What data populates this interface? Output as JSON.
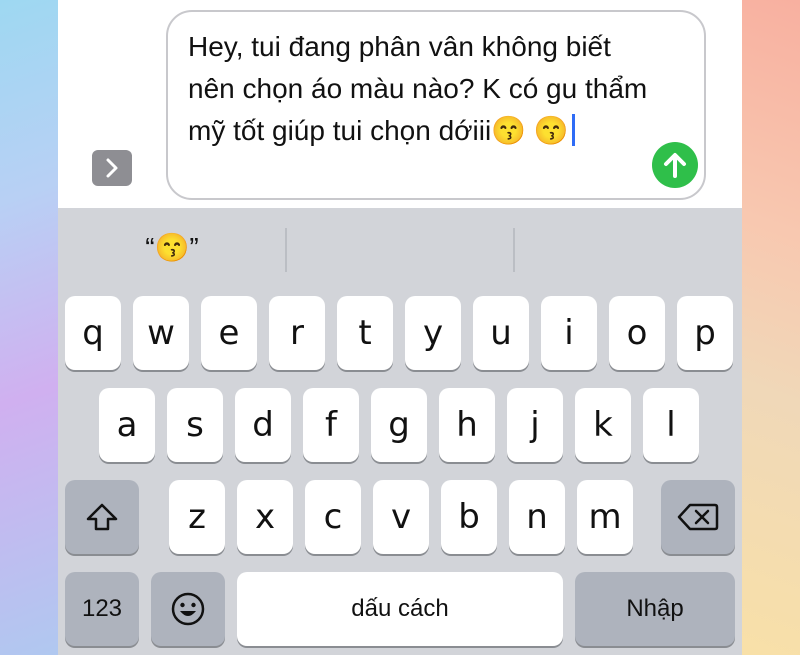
{
  "compose": {
    "message": "Hey, tui đang phân vân không biết nên chọn áo màu nào? K có gu thẩm mỹ tốt giúp tui chọn dớiii😙 😙"
  },
  "suggestions": [
    "“😙”",
    "",
    ""
  ],
  "keyboard": {
    "row1": [
      "q",
      "w",
      "e",
      "r",
      "t",
      "y",
      "u",
      "i",
      "o",
      "p"
    ],
    "row2": [
      "a",
      "s",
      "d",
      "f",
      "g",
      "h",
      "j",
      "k",
      "l"
    ],
    "row3": [
      "z",
      "x",
      "c",
      "v",
      "b",
      "n",
      "m"
    ],
    "numbers_label": "123",
    "space_label": "dấu cách",
    "return_label": "Nhập"
  },
  "icons": {
    "expand": "chevron-right-icon",
    "send": "arrow-up-icon",
    "shift": "shift-icon",
    "delete": "delete-icon",
    "emoji": "emoji-icon"
  },
  "colors": {
    "send": "#2fbf4a",
    "caret": "#2f6cf6",
    "keyboard_bg": "#d2d4d9",
    "function_key": "#aeb3bd"
  }
}
